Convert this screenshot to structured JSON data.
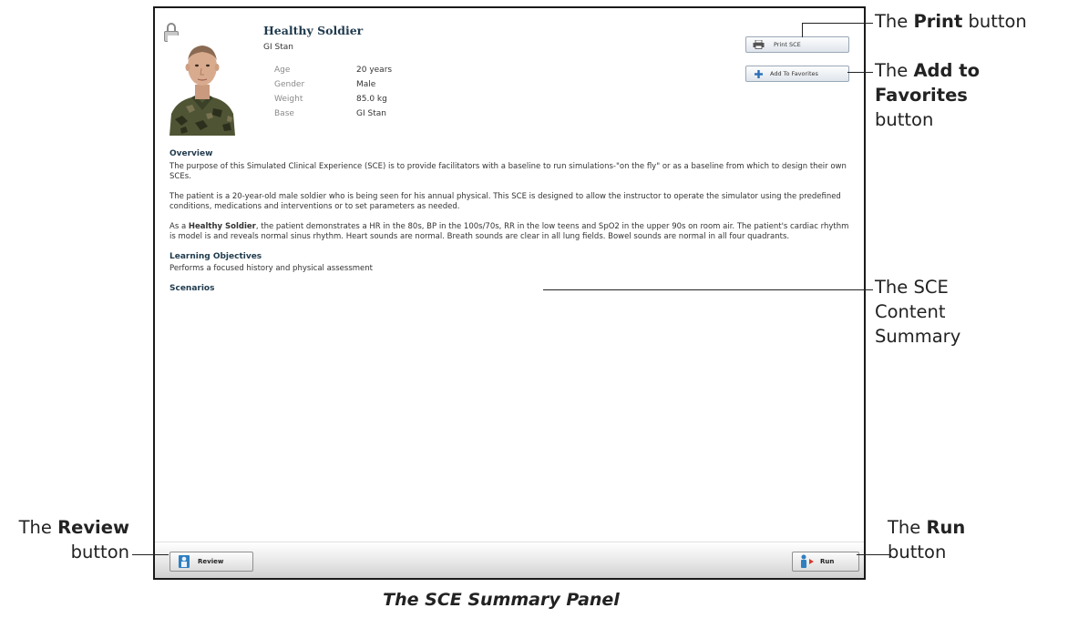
{
  "panel": {
    "patient": {
      "name": "Healthy Soldier",
      "subtitle": "GI Stan",
      "details": [
        {
          "label": "Age",
          "value": "20 years"
        },
        {
          "label": "Gender",
          "value": "Male"
        },
        {
          "label": "Weight",
          "value": "85.0 kg"
        },
        {
          "label": "Base",
          "value": "GI Stan"
        }
      ]
    },
    "buttons": {
      "print": "Print SCE",
      "favorites": "Add To Favorites",
      "review": "Review",
      "run": "Run"
    },
    "overview": {
      "heading": "Overview",
      "p1": "The purpose of this Simulated Clinical Experience (SCE) is to provide facilitators with a baseline to run simulations-\"on the fly\" or as a baseline from which to design their own SCEs.",
      "p2": "The patient is a 20-year-old male soldier who is being seen for his annual physical. This SCE is designed to allow the instructor to operate the simulator using the predefined conditions, medications and interventions or to set parameters as needed.",
      "p3_prefix": "As a ",
      "p3_bold": "Healthy Soldier",
      "p3_rest": ", the patient demonstrates a HR in the 80s, BP in the 100s/70s, RR in the low teens and SpO2 in the upper 90s on room air. The patient's cardiac rhythm is model is and reveals normal sinus rhythm. Heart sounds are normal. Breath sounds are clear in all lung fields. Bowel sounds are normal in all four quadrants."
    },
    "learning_objectives": {
      "heading": "Learning Objectives",
      "text": "Performs a focused history and physical assessment"
    },
    "scenarios": {
      "heading": "Scenarios"
    },
    "icons": [
      "lock-icon",
      "printer-icon",
      "plus-icon",
      "review-icon",
      "run-icon"
    ]
  },
  "annotations": {
    "print": {
      "prefix": "The ",
      "bold": "Print",
      "suffix": " button"
    },
    "favorites": {
      "prefix": "The ",
      "bold": "Add to Favorites",
      "suffix": "button"
    },
    "summary": {
      "line1": "The SCE",
      "line2": "Content",
      "line3": "Summary"
    },
    "review": {
      "prefix": "The ",
      "bold": "Review",
      "suffix": "button"
    },
    "run": {
      "prefix": "The ",
      "bold": "Run",
      "suffix": "button"
    }
  },
  "caption": "The SCE Summary Panel",
  "colors": {
    "heading": "#1f3a4d",
    "plus": "#2a6fb8",
    "review_icon": "#2f7fc1"
  }
}
